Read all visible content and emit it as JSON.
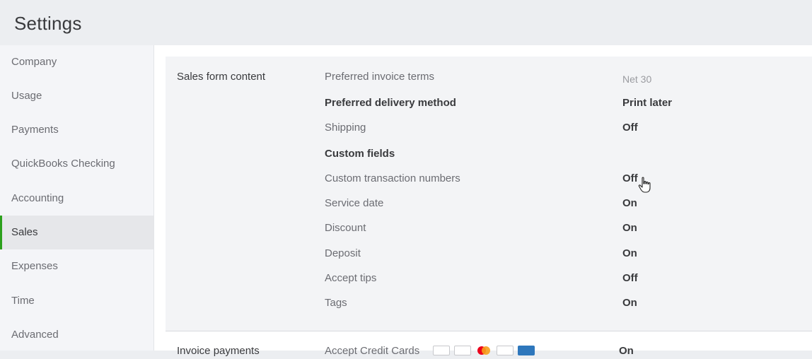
{
  "header": {
    "title": "Settings"
  },
  "sidebar": {
    "items": [
      {
        "label": "Company"
      },
      {
        "label": "Usage"
      },
      {
        "label": "Payments"
      },
      {
        "label": "QuickBooks Checking"
      },
      {
        "label": "Accounting"
      },
      {
        "label": "Sales",
        "active": true
      },
      {
        "label": "Expenses"
      },
      {
        "label": "Time"
      },
      {
        "label": "Advanced"
      }
    ]
  },
  "sales_form": {
    "title": "Sales form content",
    "rows": [
      {
        "label": "Preferred invoice terms",
        "value": "Net 30"
      },
      {
        "label": "Preferred delivery method",
        "value": "Print later"
      },
      {
        "label": "Shipping",
        "value": "Off"
      },
      {
        "label": "Custom fields",
        "value": ""
      },
      {
        "label": "Custom transaction numbers",
        "value": "Off"
      },
      {
        "label": "Service date",
        "value": "On"
      },
      {
        "label": "Discount",
        "value": "On"
      },
      {
        "label": "Deposit",
        "value": "On"
      },
      {
        "label": "Accept tips",
        "value": "Off"
      },
      {
        "label": "Tags",
        "value": "On"
      }
    ]
  },
  "invoice_payments": {
    "title": "Invoice payments",
    "row_label": "Accept Credit Cards",
    "value": "On"
  },
  "colors": {
    "accent": "#2ca01c"
  }
}
